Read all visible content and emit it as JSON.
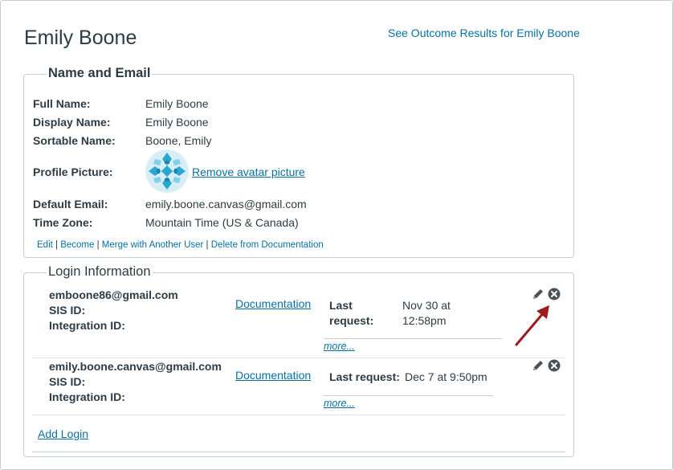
{
  "header": {
    "title": "Emily Boone",
    "outcome_link": "See Outcome Results for Emily Boone"
  },
  "name_email": {
    "legend": "Name and Email",
    "full_name_label": "Full Name:",
    "full_name": "Emily Boone",
    "display_name_label": "Display Name:",
    "display_name": "Emily Boone",
    "sortable_name_label": "Sortable Name:",
    "sortable_name": "Boone, Emily",
    "profile_picture_label": "Profile Picture:",
    "remove_avatar": "Remove avatar picture",
    "default_email_label": "Default Email:",
    "default_email": "emily.boone.canvas@gmail.com",
    "time_zone_label": "Time Zone:",
    "time_zone": "Mountain Time (US & Canada)",
    "actions": {
      "edit": "Edit",
      "become": "Become",
      "merge": "Merge with Another User",
      "delete": "Delete from Documentation",
      "separator": " | "
    }
  },
  "login_info": {
    "legend": "Login Information",
    "sis_id_label": "SIS ID:",
    "integration_id_label": "Integration ID:",
    "logins": [
      {
        "login_id": "emboone86@gmail.com",
        "auth_provider": "Documentation",
        "last_request_label_line1": "Last",
        "last_request_label_line2": "request:",
        "last_request_line1": "Nov 30 at",
        "last_request_line2": "12:58pm",
        "more": "more..."
      },
      {
        "login_id": "emily.boone.canvas@gmail.com",
        "auth_provider": "Documentation",
        "last_request_label": "Last request:",
        "last_request": "Dec 7 at 9:50pm",
        "more": "more..."
      }
    ],
    "add_login": "Add Login"
  },
  "colors": {
    "link": "#0770a3",
    "text": "#2d3b45",
    "border": "#c7cdd1",
    "annotation_arrow": "#9b1b1e"
  }
}
